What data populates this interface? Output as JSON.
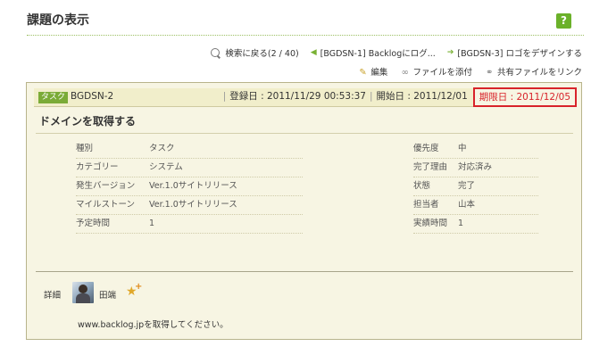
{
  "page": {
    "title": "課題の表示",
    "help_label": "?"
  },
  "nav": {
    "back_label": "検索に戻る(2 / 40)",
    "prev_label": "[BGDSN-1] Backlogにログ...",
    "next_label": "[BGDSN-3] ロゴをデザインする"
  },
  "actions": {
    "edit": "編集",
    "attach": "ファイルを添付",
    "link_shared": "共有ファイルをリンク"
  },
  "issue": {
    "type": "タスク",
    "key": "BGDSN-2",
    "registered": "登録日 : 2011/11/29 00:53:37",
    "start": "開始日 : 2011/12/01",
    "due": "期限日 : 2011/12/05",
    "summary": "ドメインを取得する",
    "left_props": [
      {
        "label": "種別",
        "value": "タスク"
      },
      {
        "label": "カテゴリー",
        "value": "システム"
      },
      {
        "label": "発生バージョン",
        "value": "Ver.1.0サイトリリース"
      },
      {
        "label": "マイルストーン",
        "value": "Ver.1.0サイトリリース"
      },
      {
        "label": "予定時間",
        "value": "1"
      }
    ],
    "right_props": [
      {
        "label": "優先度",
        "value": "中"
      },
      {
        "label": "完了理由",
        "value": "対応済み"
      },
      {
        "label": "状態",
        "value": "完了"
      },
      {
        "label": "担当者",
        "value": "山本"
      },
      {
        "label": "実績時間",
        "value": "1"
      }
    ],
    "detail_label": "詳細",
    "assignee_name": "田端",
    "description": "www.backlog.jpを取得してください。"
  },
  "colors": {
    "accent_green": "#7bab37",
    "due_red": "#d8232a",
    "card_bg": "#f7f5e3"
  }
}
